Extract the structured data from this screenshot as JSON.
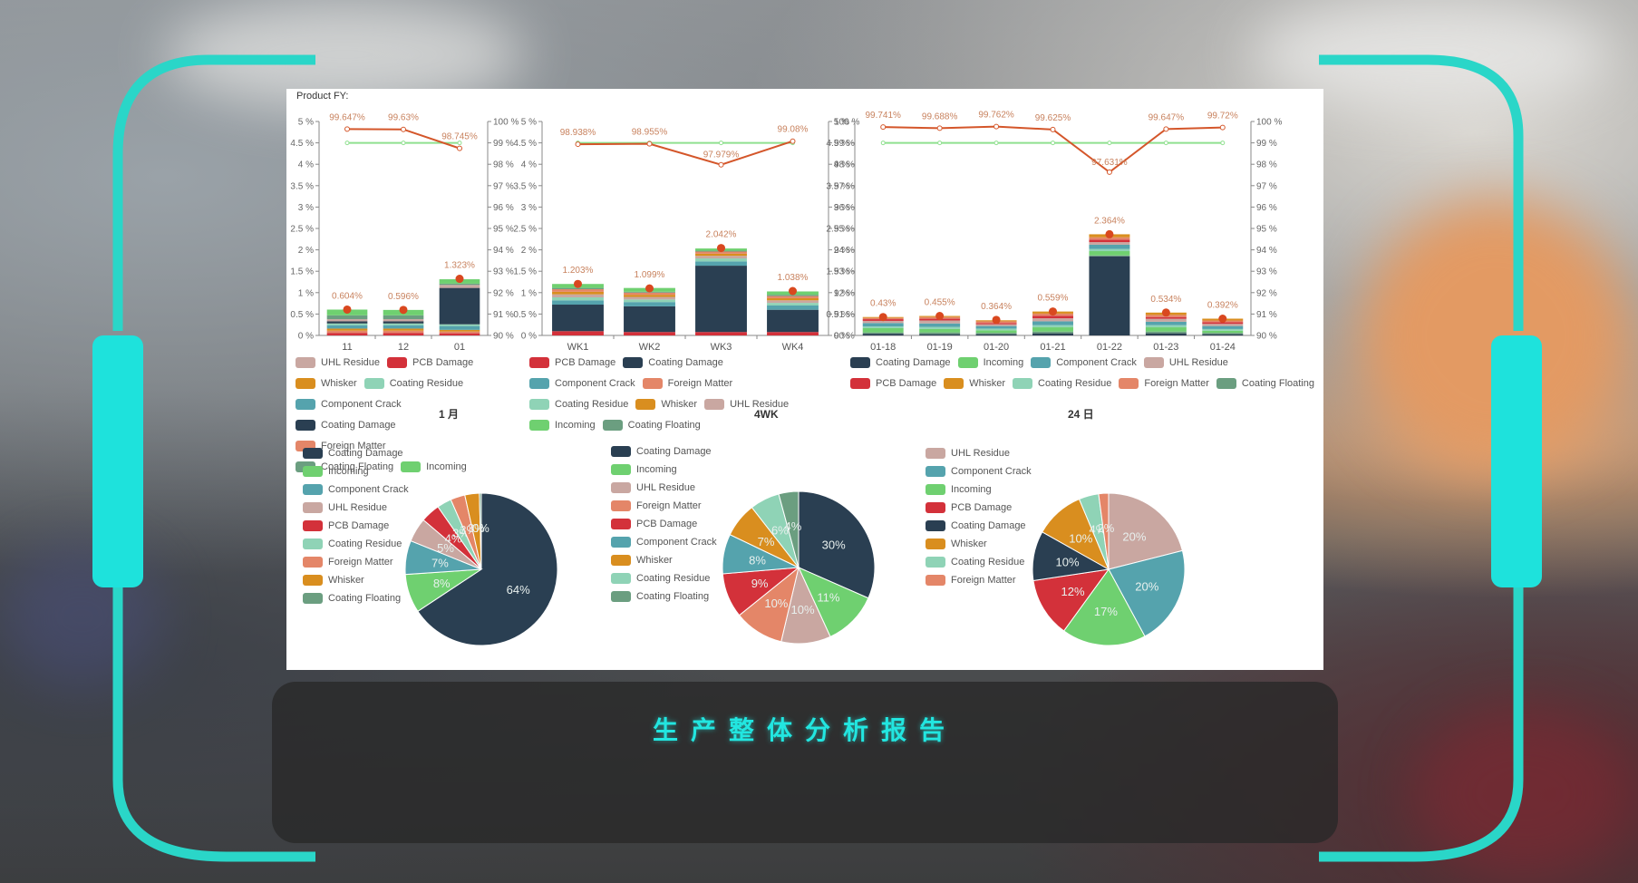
{
  "header": {
    "product_label": "Product FY:"
  },
  "caption": {
    "text": "生产整体分析报告"
  },
  "colors": {
    "UHL Residue": "#c9a7a1",
    "PCB Damage": "#d3313a",
    "Whisker": "#d98e1f",
    "Coating Residue": "#8fd3b6",
    "Component Crack": "#55a3ad",
    "Coating Damage": "#2a3f52",
    "Foreign Matter": "#e48668",
    "Coating Floating": "#6b9e80",
    "Incoming": "#6fd070",
    "fy_line": "#d4562a",
    "target_line": "#8fe08f",
    "accent": "#22e6e0"
  },
  "chart_data": [
    {
      "type": "bar",
      "id": "monthly",
      "categories": [
        "11",
        "12",
        "01"
      ],
      "left_axis": {
        "ticks": [
          "0 %",
          "0.5 %",
          "1 %",
          "1.5 %",
          "2 %",
          "2.5 %",
          "3 %",
          "3.5 %",
          "4 %",
          "4.5 %",
          "5 %"
        ],
        "ylim": [
          0,
          5
        ]
      },
      "right_axis": {
        "ticks": [
          "90 %",
          "91 %",
          "92 %",
          "93 %",
          "94 %",
          "95 %",
          "96 %",
          "97 %",
          "98 %",
          "99 %",
          "100 %"
        ],
        "ylim": [
          90,
          100
        ]
      },
      "stack_order": [
        "PCB Damage",
        "Foreign Matter",
        "Whisker",
        "Component Crack",
        "Coating Residue",
        "Coating Damage",
        "UHL Residue",
        "Coating Floating",
        "Incoming"
      ],
      "series": [
        {
          "name": "PCB Damage",
          "values": [
            0.06,
            0.06,
            0.05
          ]
        },
        {
          "name": "Foreign Matter",
          "values": [
            0.05,
            0.05,
            0.04
          ]
        },
        {
          "name": "Whisker",
          "values": [
            0.05,
            0.05,
            0.04
          ]
        },
        {
          "name": "Component Crack",
          "values": [
            0.08,
            0.08,
            0.09
          ]
        },
        {
          "name": "Coating Residue",
          "values": [
            0.04,
            0.04,
            0.04
          ]
        },
        {
          "name": "Coating Damage",
          "values": [
            0.05,
            0.05,
            0.85
          ]
        },
        {
          "name": "UHL Residue",
          "values": [
            0.05,
            0.05,
            0.07
          ]
        },
        {
          "name": "Coating Floating",
          "values": [
            0.09,
            0.09,
            0.03
          ]
        },
        {
          "name": "Incoming",
          "values": [
            0.134,
            0.126,
            0.103
          ]
        }
      ],
      "totals": [
        0.604,
        0.596,
        1.323
      ],
      "total_labels": [
        "0.604%",
        "0.596%",
        "1.323%"
      ],
      "fy": [
        99.647,
        99.63,
        98.745
      ],
      "fy_labels": [
        "99.647%",
        "99.63%",
        "98.745%"
      ],
      "target": [
        99,
        99,
        99
      ],
      "legend": [
        "UHL Residue",
        "PCB Damage",
        "Whisker",
        "Coating Residue",
        "Component Crack",
        "Coating Damage",
        "Foreign Matter",
        "Coating Floating",
        "Incoming"
      ]
    },
    {
      "type": "bar",
      "id": "weekly",
      "categories": [
        "WK1",
        "WK2",
        "WK3",
        "WK4"
      ],
      "left_axis": {
        "ticks": [
          "0 %",
          "0.5 %",
          "1 %",
          "1.5 %",
          "2 %",
          "2.5 %",
          "3 %",
          "3.5 %",
          "4 %",
          "4.5 %",
          "5 %"
        ],
        "ylim": [
          0,
          5
        ]
      },
      "right_axis": {
        "ticks": [
          "90 %",
          "91 %",
          "92 %",
          "93 %",
          "94 %",
          "95 %",
          "96 %",
          "97 %",
          "98 %",
          "99 %",
          "100 %"
        ],
        "ylim": [
          90,
          100
        ]
      },
      "stack_order": [
        "PCB Damage",
        "Coating Damage",
        "Component Crack",
        "Coating Residue",
        "UHL Residue",
        "Whisker",
        "Foreign Matter",
        "Coating Floating",
        "Incoming"
      ],
      "series": [
        {
          "name": "PCB Damage",
          "values": [
            0.1,
            0.08,
            0.08,
            0.08
          ]
        },
        {
          "name": "Coating Damage",
          "values": [
            0.62,
            0.6,
            1.55,
            0.52
          ]
        },
        {
          "name": "Component Crack",
          "values": [
            0.1,
            0.1,
            0.1,
            0.1
          ]
        },
        {
          "name": "Coating Residue",
          "values": [
            0.07,
            0.06,
            0.07,
            0.06
          ]
        },
        {
          "name": "UHL Residue",
          "values": [
            0.07,
            0.06,
            0.06,
            0.06
          ]
        },
        {
          "name": "Whisker",
          "values": [
            0.06,
            0.05,
            0.05,
            0.05
          ]
        },
        {
          "name": "Foreign Matter",
          "values": [
            0.06,
            0.05,
            0.05,
            0.05
          ]
        },
        {
          "name": "Coating Floating",
          "values": [
            0.03,
            0.02,
            0.02,
            0.03
          ]
        },
        {
          "name": "Incoming",
          "values": [
            0.093,
            0.089,
            0.052,
            0.078
          ]
        }
      ],
      "totals": [
        1.203,
        1.099,
        2.042,
        1.038
      ],
      "total_labels": [
        "1.203%",
        "1.099%",
        "2.042%",
        "1.038%"
      ],
      "fy": [
        98.938,
        98.955,
        97.979,
        99.08
      ],
      "fy_labels": [
        "98.938%",
        "98.955%",
        "97.979%",
        "99.08%"
      ],
      "target": [
        99,
        99,
        99,
        99
      ],
      "legend": [
        "PCB Damage",
        "Coating Damage",
        "Component Crack",
        "Foreign Matter",
        "Coating Residue",
        "Whisker",
        "UHL Residue",
        "Incoming",
        "Coating Floating"
      ]
    },
    {
      "type": "bar",
      "id": "daily",
      "categories": [
        "01-18",
        "01-19",
        "01-20",
        "01-21",
        "01-22",
        "01-23",
        "01-24"
      ],
      "left_axis": {
        "ticks": [
          "0 %",
          "0.5 %",
          "1 %",
          "1.5 %",
          "2 %",
          "2.5 %",
          "3 %",
          "3.5 %",
          "4 %",
          "4.5 %",
          "5 %"
        ],
        "ylim": [
          0,
          5
        ]
      },
      "right_axis": {
        "ticks": [
          "90 %",
          "91 %",
          "92 %",
          "93 %",
          "94 %",
          "95 %",
          "96 %",
          "97 %",
          "98 %",
          "99 %",
          "100 %"
        ],
        "ylim": [
          90,
          100
        ]
      },
      "stack_order": [
        "Coating Damage",
        "Coating Floating",
        "Incoming",
        "Coating Residue",
        "Component Crack",
        "UHL Residue",
        "PCB Damage",
        "Foreign Matter",
        "Whisker"
      ],
      "series": [
        {
          "name": "Coating Damage",
          "values": [
            0.04,
            0.03,
            0.03,
            0.05,
            1.85,
            0.05,
            0.03
          ]
        },
        {
          "name": "Coating Floating",
          "values": [
            0.03,
            0.04,
            0.03,
            0.04,
            0.02,
            0.04,
            0.03
          ]
        },
        {
          "name": "Incoming",
          "values": [
            0.1,
            0.08,
            0.06,
            0.1,
            0.1,
            0.1,
            0.05
          ]
        },
        {
          "name": "Coating Residue",
          "values": [
            0.04,
            0.05,
            0.04,
            0.05,
            0.05,
            0.05,
            0.04
          ]
        },
        {
          "name": "Component Crack",
          "values": [
            0.08,
            0.08,
            0.06,
            0.09,
            0.1,
            0.08,
            0.07
          ]
        },
        {
          "name": "UHL Residue",
          "values": [
            0.05,
            0.07,
            0.04,
            0.07,
            0.06,
            0.07,
            0.05
          ]
        },
        {
          "name": "PCB Damage",
          "values": [
            0.04,
            0.04,
            0.03,
            0.06,
            0.06,
            0.04,
            0.04
          ]
        },
        {
          "name": "Foreign Matter",
          "values": [
            0.03,
            0.04,
            0.04,
            0.05,
            0.054,
            0.05,
            0.04
          ]
        },
        {
          "name": "Whisker",
          "values": [
            0.02,
            0.025,
            0.024,
            0.049,
            0.07,
            0.054,
            0.042
          ]
        }
      ],
      "totals": [
        0.43,
        0.455,
        0.364,
        0.559,
        2.364,
        0.534,
        0.392
      ],
      "total_labels": [
        "0.43%",
        "0.455%",
        "0.364%",
        "0.559%",
        "2.364%",
        "0.534%",
        "0.392%"
      ],
      "fy": [
        99.741,
        99.688,
        99.762,
        99.625,
        97.631,
        99.647,
        99.72
      ],
      "fy_labels": [
        "99.741%",
        "99.688%",
        "99.762%",
        "99.625%",
        "97.631%",
        "99.647%",
        "99.72%"
      ],
      "target": [
        99,
        99,
        99,
        99,
        99,
        99,
        99
      ],
      "legend": [
        "Coating Damage",
        "Incoming",
        "Component Crack",
        "UHL Residue",
        "PCB Damage",
        "Whisker",
        "Coating Residue",
        "Foreign Matter",
        "Coating Floating"
      ]
    },
    {
      "type": "pie",
      "id": "pie-month",
      "title": "1 月",
      "slices": [
        {
          "name": "Coating Damage",
          "value": 64,
          "label": "64%"
        },
        {
          "name": "Incoming",
          "value": 8,
          "label": "8%"
        },
        {
          "name": "Component Crack",
          "value": 7,
          "label": "7%"
        },
        {
          "name": "UHL Residue",
          "value": 5,
          "label": "5%"
        },
        {
          "name": "PCB Damage",
          "value": 4,
          "label": "4%"
        },
        {
          "name": "Coating Residue",
          "value": 3,
          "label": "3%"
        },
        {
          "name": "Foreign Matter",
          "value": 3,
          "label": "3%"
        },
        {
          "name": "Whisker",
          "value": 3,
          "label": "3%"
        },
        {
          "name": "Coating Floating",
          "value": 0.4,
          "label": "0%"
        }
      ]
    },
    {
      "type": "pie",
      "id": "pie-4wk",
      "title": "4WK",
      "slices": [
        {
          "name": "Coating Damage",
          "value": 30,
          "label": "30%"
        },
        {
          "name": "Incoming",
          "value": 11,
          "label": "11%"
        },
        {
          "name": "UHL Residue",
          "value": 10,
          "label": "10%"
        },
        {
          "name": "Foreign Matter",
          "value": 10,
          "label": "10%"
        },
        {
          "name": "PCB Damage",
          "value": 9,
          "label": "9%"
        },
        {
          "name": "Component Crack",
          "value": 8,
          "label": "8%"
        },
        {
          "name": "Whisker",
          "value": 7,
          "label": "7%"
        },
        {
          "name": "Coating Residue",
          "value": 6,
          "label": "6%"
        },
        {
          "name": "Coating Floating",
          "value": 4,
          "label": "4%"
        }
      ]
    },
    {
      "type": "pie",
      "id": "pie-day",
      "title": "24 日",
      "slices": [
        {
          "name": "UHL Residue",
          "value": 20,
          "label": "20%"
        },
        {
          "name": "Component Crack",
          "value": 20,
          "label": "20%"
        },
        {
          "name": "Incoming",
          "value": 17,
          "label": "17%"
        },
        {
          "name": "PCB Damage",
          "value": 12,
          "label": "12%"
        },
        {
          "name": "Coating Damage",
          "value": 10,
          "label": "10%"
        },
        {
          "name": "Whisker",
          "value": 10,
          "label": "10%"
        },
        {
          "name": "Coating Residue",
          "value": 4,
          "label": "4%"
        },
        {
          "name": "Foreign Matter",
          "value": 2,
          "label": "2%"
        }
      ]
    }
  ]
}
